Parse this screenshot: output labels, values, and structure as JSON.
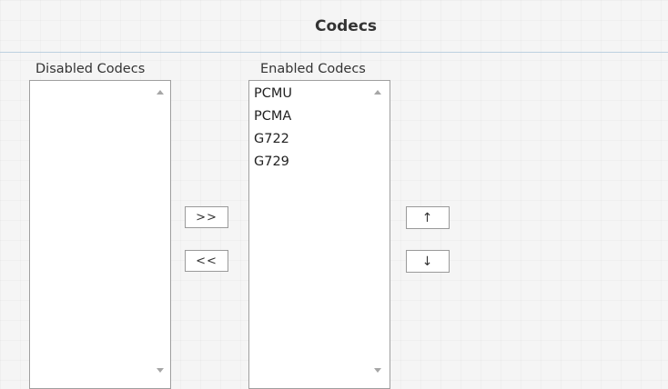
{
  "section": {
    "title": "Codecs"
  },
  "disabled_list": {
    "label": "Disabled Codecs",
    "items": []
  },
  "enabled_list": {
    "label": "Enabled Codecs",
    "items": [
      "PCMU",
      "PCMA",
      "G722",
      "G729"
    ]
  },
  "buttons": {
    "add": ">>",
    "remove": "<<",
    "move_up": "↑",
    "move_down": "↓"
  },
  "icons": {
    "scroll_up": "triangle-up",
    "scroll_down": "triangle-down"
  }
}
